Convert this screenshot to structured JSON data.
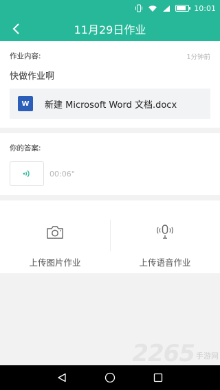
{
  "status_bar": {
    "time": "10:01"
  },
  "header": {
    "title": "11月29日作业"
  },
  "homework": {
    "label": "作业内容:",
    "time_ago": "1分钟前",
    "text": "快做作业啊",
    "attachment": {
      "icon_letter": "W",
      "name": "新建 Microsoft Word 文档.docx"
    }
  },
  "answer": {
    "label": "你的答案:",
    "voice_duration": "00:06\""
  },
  "upload": {
    "photo_label": "上传图片作业",
    "voice_label": "上传语音作业"
  },
  "watermark": {
    "number": "2265",
    "site": "手游网"
  },
  "colors": {
    "accent": "#27b89a",
    "word_blue": "#2b5eb8"
  }
}
